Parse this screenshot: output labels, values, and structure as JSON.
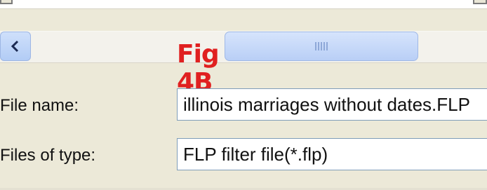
{
  "scrollbar": {
    "thumb_grip": "|||"
  },
  "annotation": {
    "label": "Fig 4B",
    "color": "#e02020"
  },
  "file_name": {
    "label": "File name:",
    "value": "illinois marriages without dates.FLP"
  },
  "file_type": {
    "label": "Files of type:",
    "value": "FLP filter file(*.flp)"
  },
  "colors": {
    "dialog_background": "#ece9d8",
    "scrollbar_blue": "#b9cff6"
  }
}
